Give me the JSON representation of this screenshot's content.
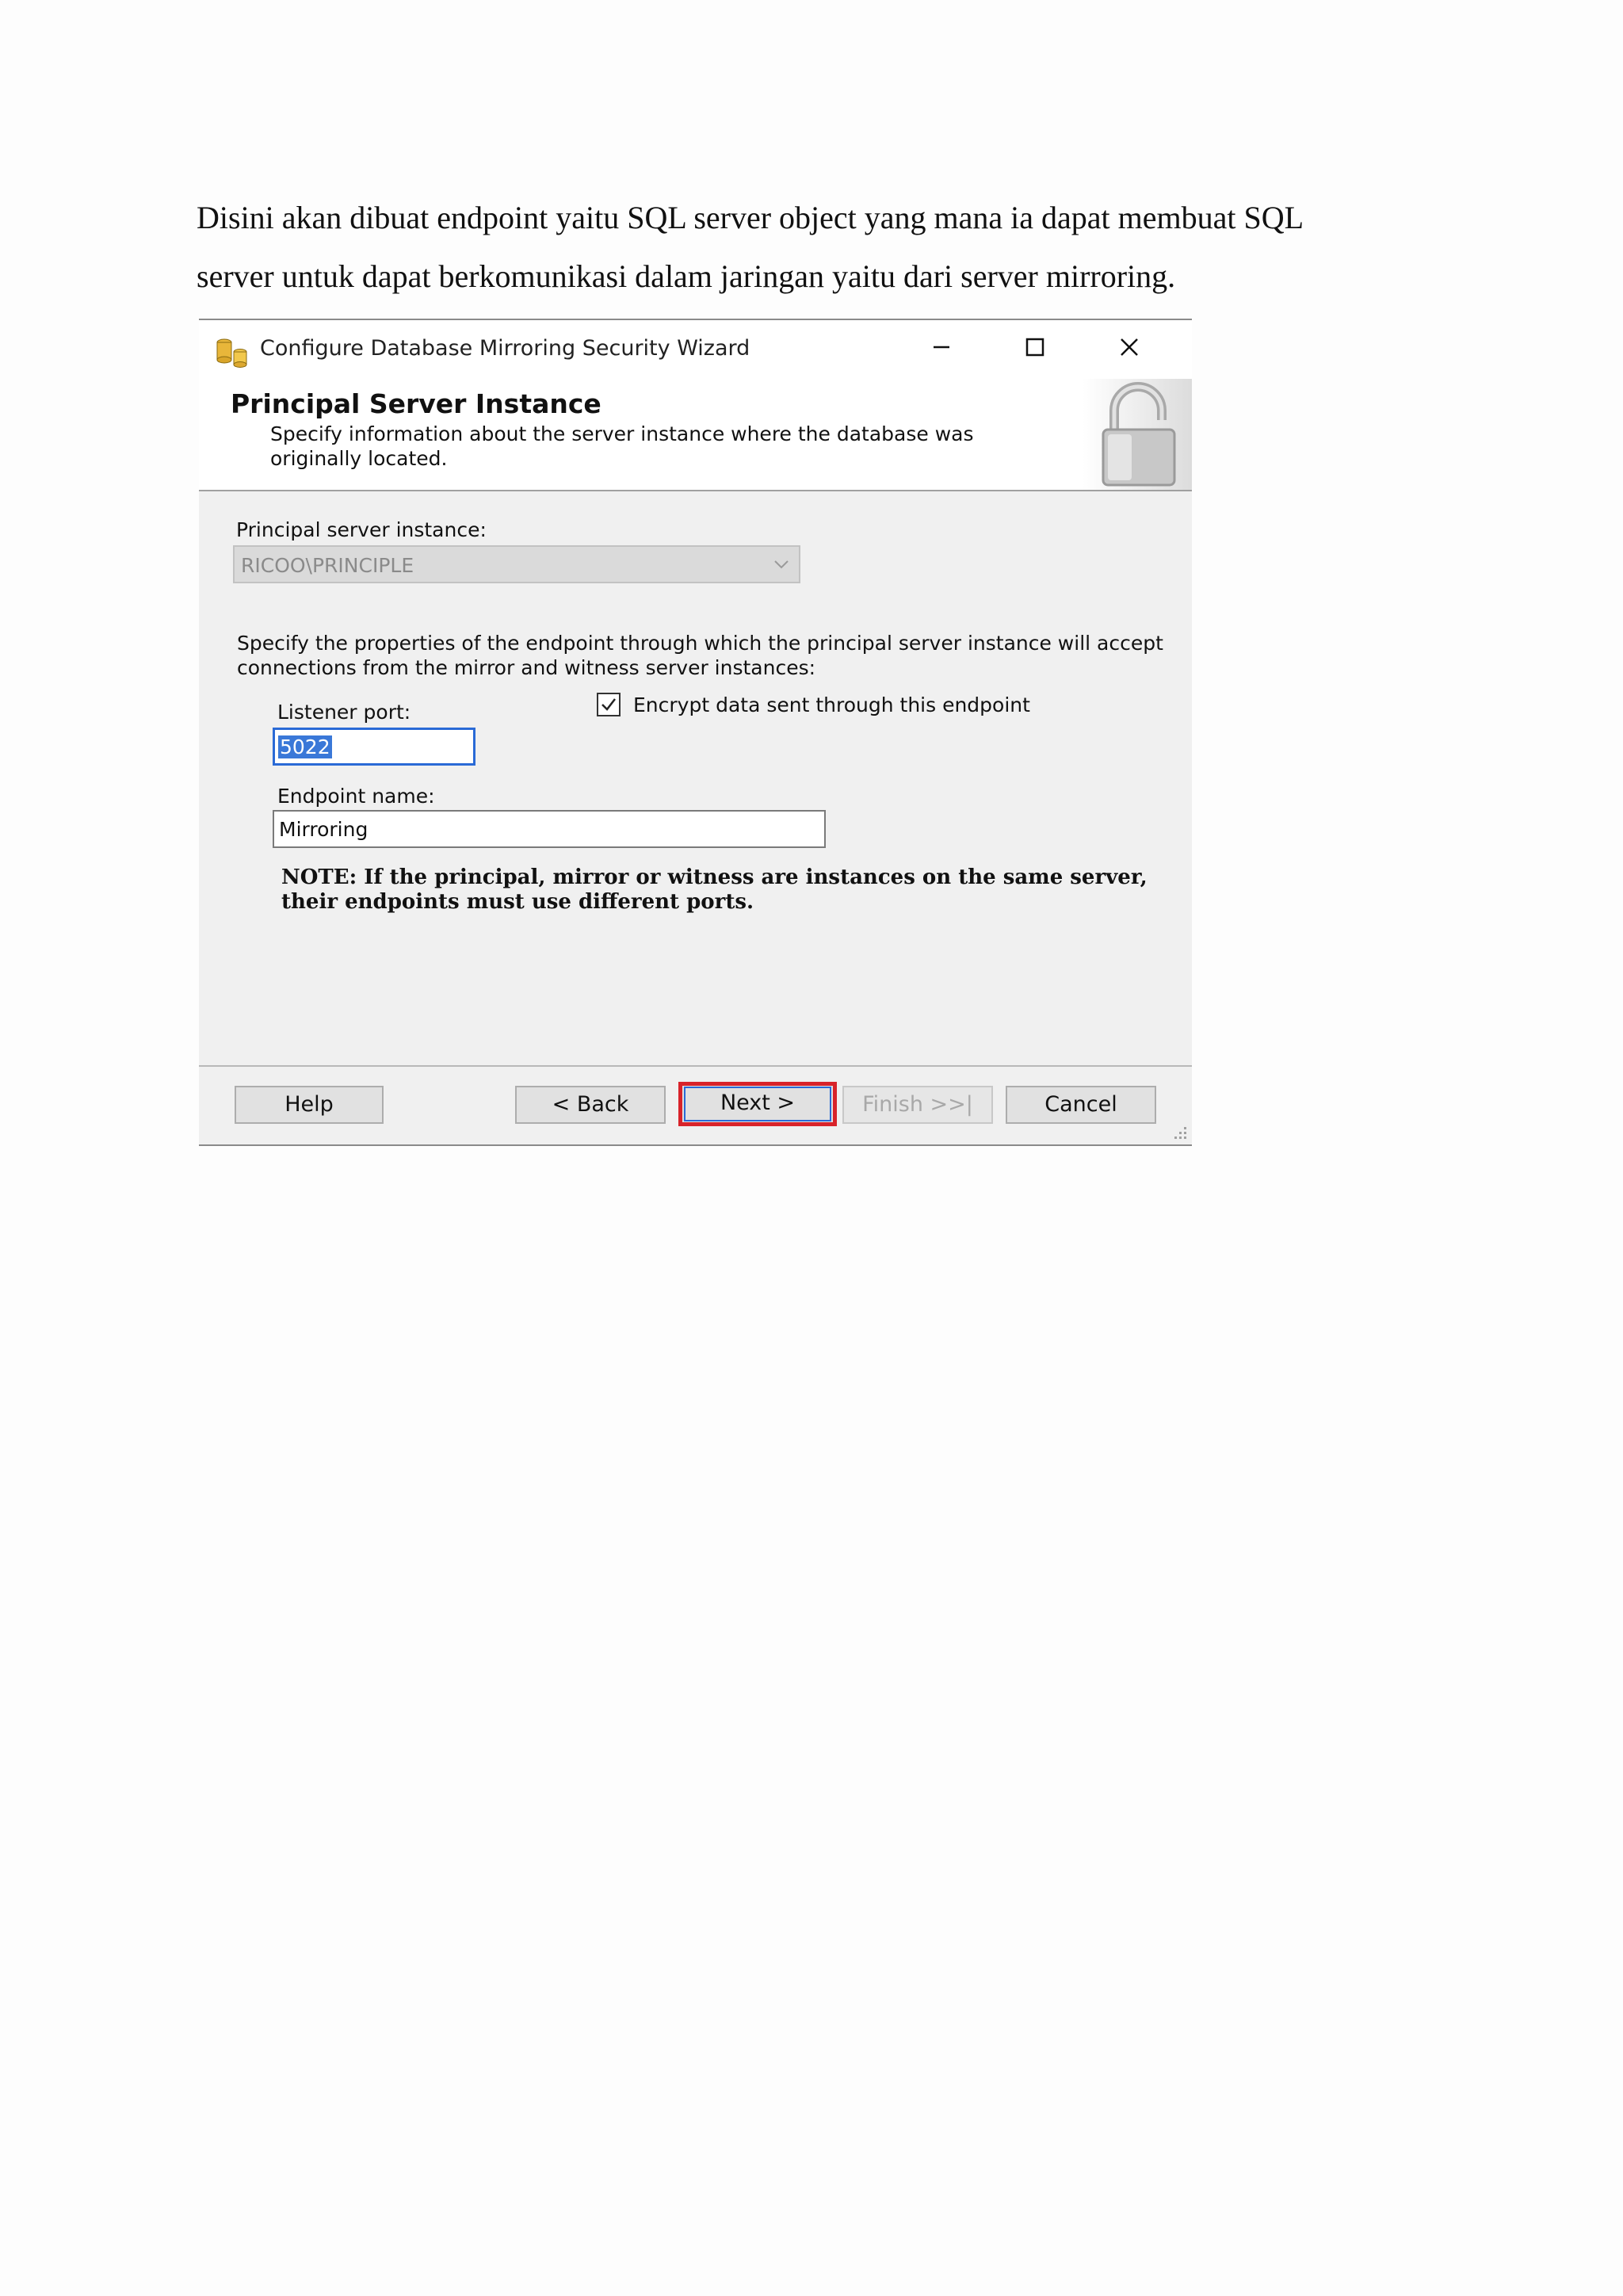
{
  "paragraph": {
    "line1": "Disini akan dibuat endpoint yaitu SQL server object yang mana ia dapat membuat SQL",
    "line2": "server untuk dapat berkomunikasi dalam jaringan yaitu dari server mirroring."
  },
  "window": {
    "title": "Configure Database Mirroring Security Wizard"
  },
  "header": {
    "title": "Principal Server Instance",
    "description": "Specify information about the server instance where the database was originally located."
  },
  "form": {
    "principal_label": "Principal server instance:",
    "principal_value": "RICOO\\PRINCIPLE",
    "properties_desc": "Specify the properties of the endpoint through which the principal server instance will accept connections from the mirror and witness server instances:",
    "listener_label": "Listener port:",
    "listener_value": "5022",
    "encrypt_label": "Encrypt data sent through this endpoint",
    "encrypt_checked": true,
    "endpoint_label": "Endpoint name:",
    "endpoint_value": "Mirroring",
    "note": "NOTE: If the principal, mirror or witness are instances on the same server, their endpoints must use different ports."
  },
  "buttons": {
    "help": "Help",
    "back": "< Back",
    "next": "Next >",
    "finish": "Finish >>|",
    "cancel": "Cancel"
  },
  "colors": {
    "highlight_border": "#d8232a",
    "selection": "#3a78d8"
  }
}
